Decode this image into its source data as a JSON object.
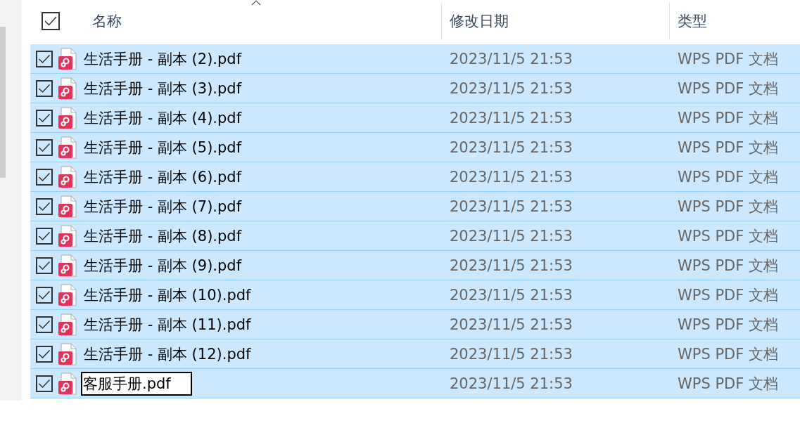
{
  "header": {
    "all_checked": true,
    "columns": [
      {
        "label": "名称",
        "sorted": true
      },
      {
        "label": "修改日期",
        "sorted": false
      },
      {
        "label": "类型",
        "sorted": false
      }
    ]
  },
  "rows": [
    {
      "name": "生活手册 - 副本 (2).pdf",
      "date": "2023/11/5 21:53",
      "type": "WPS PDF 文档",
      "selected": true,
      "checked": true,
      "editing": false
    },
    {
      "name": "生活手册 - 副本 (3).pdf",
      "date": "2023/11/5 21:53",
      "type": "WPS PDF 文档",
      "selected": true,
      "checked": true,
      "editing": false
    },
    {
      "name": "生活手册 - 副本 (4).pdf",
      "date": "2023/11/5 21:53",
      "type": "WPS PDF 文档",
      "selected": true,
      "checked": true,
      "editing": false
    },
    {
      "name": "生活手册 - 副本 (5).pdf",
      "date": "2023/11/5 21:53",
      "type": "WPS PDF 文档",
      "selected": true,
      "checked": true,
      "editing": false
    },
    {
      "name": "生活手册 - 副本 (6).pdf",
      "date": "2023/11/5 21:53",
      "type": "WPS PDF 文档",
      "selected": true,
      "checked": true,
      "editing": false
    },
    {
      "name": "生活手册 - 副本 (7).pdf",
      "date": "2023/11/5 21:53",
      "type": "WPS PDF 文档",
      "selected": true,
      "checked": true,
      "editing": false
    },
    {
      "name": "生活手册 - 副本 (8).pdf",
      "date": "2023/11/5 21:53",
      "type": "WPS PDF 文档",
      "selected": true,
      "checked": true,
      "editing": false
    },
    {
      "name": "生活手册 - 副本 (9).pdf",
      "date": "2023/11/5 21:53",
      "type": "WPS PDF 文档",
      "selected": true,
      "checked": true,
      "editing": false
    },
    {
      "name": "生活手册 - 副本 (10).pdf",
      "date": "2023/11/5 21:53",
      "type": "WPS PDF 文档",
      "selected": true,
      "checked": true,
      "editing": false
    },
    {
      "name": "生活手册 - 副本 (11).pdf",
      "date": "2023/11/5 21:53",
      "type": "WPS PDF 文档",
      "selected": true,
      "checked": true,
      "editing": false
    },
    {
      "name": "生活手册 - 副本 (12).pdf",
      "date": "2023/11/5 21:53",
      "type": "WPS PDF 文档",
      "selected": true,
      "checked": true,
      "editing": false
    },
    {
      "name": "客服手册.pdf",
      "date": "2023/11/5 21:53",
      "type": "WPS PDF 文档",
      "selected": true,
      "checked": true,
      "editing": true
    }
  ]
}
